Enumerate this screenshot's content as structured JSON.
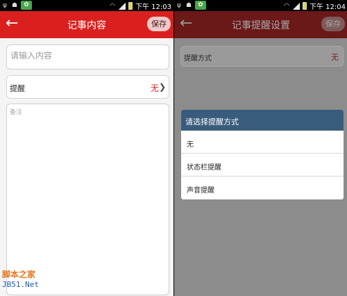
{
  "left": {
    "status": {
      "time": "下午 12:03"
    },
    "header": {
      "title": "记事内容",
      "save_label": "保存"
    },
    "content_input": {
      "placeholder": "请输入内容"
    },
    "reminder_row": {
      "label": "提醒",
      "value": "无"
    },
    "notes": {
      "placeholder": "备注"
    },
    "watermark": {
      "line1": "脚本之家",
      "line2": "JB51.Net"
    }
  },
  "right": {
    "status": {
      "time": "下午 12:04"
    },
    "header": {
      "title": "记事提醒设置",
      "save_label": "保存"
    },
    "mode_row": {
      "label": "提醒方式",
      "value": "无"
    },
    "dialog": {
      "title": "请选择提醒方式",
      "options": [
        "无",
        "状态栏提醒",
        "声音提醒"
      ]
    }
  },
  "colors": {
    "accent": "#d9201e",
    "dialog_title_bg": "#3a5c7c"
  }
}
